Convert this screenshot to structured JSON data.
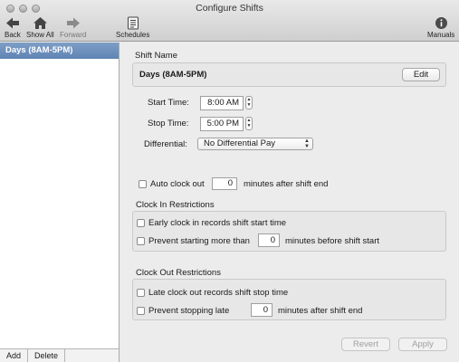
{
  "window": {
    "title": "Configure Shifts"
  },
  "toolbar": {
    "back": "Back",
    "show_all": "Show All",
    "forward": "Forward",
    "schedules": "Schedules",
    "manuals": "Manuals"
  },
  "sidebar": {
    "items": [
      {
        "label": "Days (8AM-5PM)",
        "selected": true
      }
    ],
    "add_label": "Add",
    "delete_label": "Delete"
  },
  "shift": {
    "name_heading": "Shift Name",
    "name_value": "Days (8AM-5PM)",
    "edit_label": "Edit",
    "start_label": "Start Time:",
    "start_value": "8:00 AM",
    "stop_label": "Stop Time:",
    "stop_value": "5:00 PM",
    "differential_label": "Differential:",
    "differential_value": "No Differential Pay",
    "auto_clock_label": "Auto clock out",
    "auto_clock_value": "0",
    "auto_clock_suffix": "minutes after shift end"
  },
  "clock_in": {
    "heading": "Clock In Restrictions",
    "early_label": "Early clock in records shift start time",
    "prevent_label": "Prevent starting more than",
    "prevent_value": "0",
    "prevent_suffix": "minutes before shift start"
  },
  "clock_out": {
    "heading": "Clock Out Restrictions",
    "late_label": "Late clock out records shift stop time",
    "prevent_label": "Prevent stopping late",
    "prevent_value": "0",
    "prevent_suffix": "minutes after shift end"
  },
  "footer": {
    "revert_label": "Revert",
    "apply_label": "Apply"
  }
}
